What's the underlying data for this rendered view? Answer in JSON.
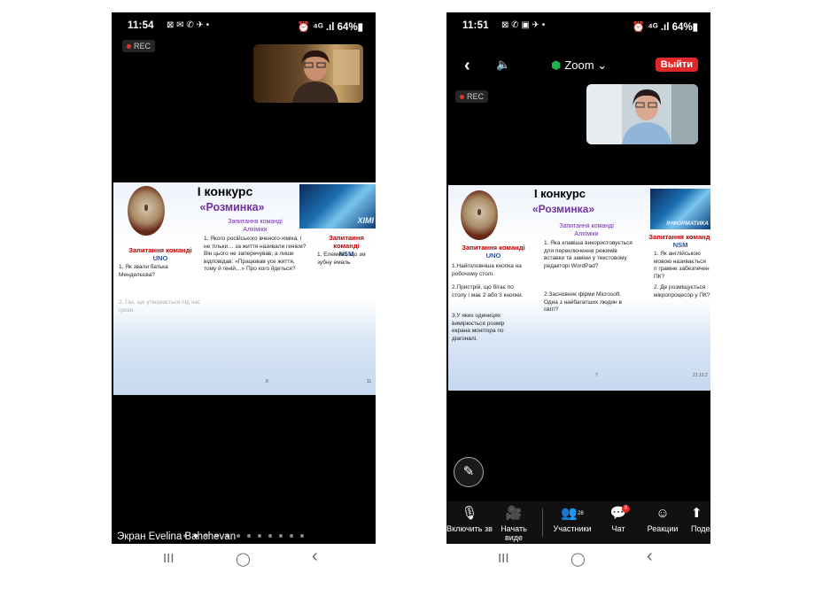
{
  "left": {
    "status": {
      "time": "11:54",
      "icons": "⊠ ✉ ✆ ✈ •",
      "right": "⏰ ⁴ᴳ .ıl 64%▮"
    },
    "rec_label": "REC",
    "slide": {
      "title": "I конкурс",
      "subtitle": "«Розминка»",
      "left_head": "Запитання команді",
      "left_team": "UNO",
      "left_q1": "1. Як звали батька Менделєєва?",
      "left_q2": "2. Газ, що утворюється під час грози.",
      "mid_head": "Запитання команді",
      "mid_team": "Алхіміки",
      "mid_q1": "1. Якого російського вченого-хіміка, і не тільки… за життя називали генієм? Він цього не заперечував, а лише відповідав: «Працював усе життя, тому й геній…» Про кого йдеться?",
      "right_head": "Запитання команді",
      "right_team": "NSM",
      "right_q1": "1. Елемент, що зм зубну емаль",
      "pic_text": "ХІМІ",
      "page": "8",
      "page2": "11"
    },
    "pager_total": 12,
    "pager_active": 1,
    "caption": "Экран Evelina Bahchevan"
  },
  "right": {
    "status": {
      "time": "11:51",
      "icons": "⊠ ✆ ▣ ✈ •",
      "right": "⏰ ⁴ᴳ .ıl 64%▮"
    },
    "top": {
      "app": "Zoom",
      "leave": "Выйти"
    },
    "rec_label": "REC",
    "slide": {
      "title": "I конкурс",
      "subtitle": "«Розминка»",
      "left_head": "Запитання команді",
      "left_team": "UNO",
      "left_q1": "1.Найголовніша кнопка на робочому столі.",
      "left_q2": "2.Пристрій, що бігає по столу і має 2 або 3 кнопки.",
      "left_q3": "3.У яких одиницях вимірюється розмір екрана монітора по діагоналі.",
      "mid_head": "Запитання команді",
      "mid_team": "Алхіміки",
      "mid_q1": "1. Яка клавіша використовується для переключення режимів вставки та заміни у текстовому редакторі WordPad?",
      "mid_q2": "2.Засновник фірми Microsoft. Одна з найбагатших людин в світі?",
      "right_head": "Запитання команді",
      "right_team": "NSM",
      "right_q1": "1. Як англійською мовою називається п грамне забезпечен ПК?",
      "right_q2": "2. Де розміщується мікропроцесор у ПК?",
      "pic_text": "ІНФОРМАТИКА",
      "page": "7",
      "date": "21.10.2"
    },
    "toolbar": {
      "mic": "Включить зв",
      "video": "Начать виде",
      "participants": "Участники",
      "participants_count": "28",
      "chat": "Чат",
      "chat_badge": "8",
      "reactions": "Реакции",
      "share": "Подел"
    }
  },
  "nav": {
    "recent": "III",
    "home": "◯",
    "back": "‹"
  }
}
